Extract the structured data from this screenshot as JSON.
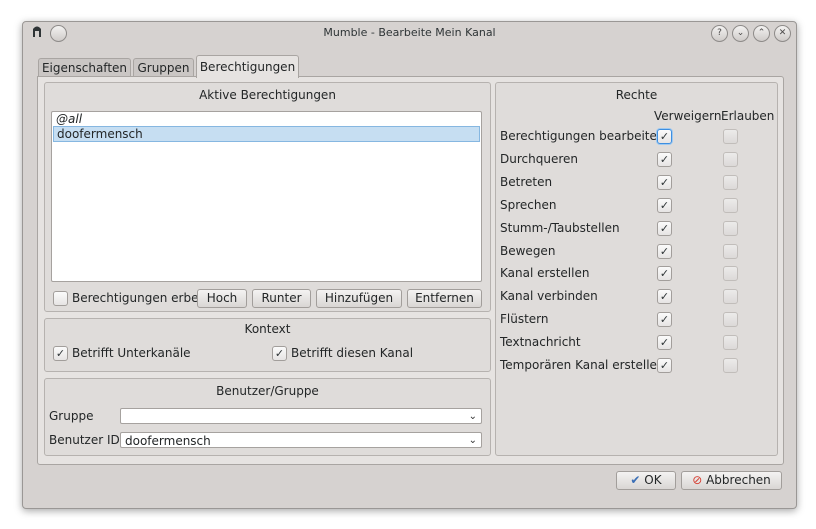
{
  "window": {
    "title": "Mumble - Bearbeite Mein Kanal",
    "controls": [
      "help-icon",
      "minimize-icon",
      "maximize-icon",
      "close-icon"
    ]
  },
  "tabs": [
    {
      "label": "Eigenschaften",
      "active": false
    },
    {
      "label": "Gruppen",
      "active": false
    },
    {
      "label": "Berechtigungen",
      "active": true
    }
  ],
  "active_permissions": {
    "title": "Aktive Berechtigungen",
    "items": [
      {
        "label": "@all",
        "italic": true,
        "selected": false
      },
      {
        "label": "doofermensch",
        "italic": false,
        "selected": true
      }
    ],
    "inherit_checkbox_label": "Berechtigungen erber",
    "inherit_checked": false,
    "buttons": {
      "up": "Hoch",
      "down": "Runter",
      "add": "Hinzufügen",
      "remove": "Entfernen"
    }
  },
  "context": {
    "title": "Kontext",
    "applies_subchannels": {
      "label": "Betrifft Unterkanäle",
      "checked": true
    },
    "applies_channel": {
      "label": "Betrifft diesen Kanal",
      "checked": true
    }
  },
  "user_group": {
    "title": "Benutzer/Gruppe",
    "group_label": "Gruppe",
    "group_value": "",
    "user_id_label": "Benutzer ID",
    "user_id_value": "doofermensch"
  },
  "rights": {
    "title": "Rechte",
    "deny_header": "Verweigern",
    "allow_header": "Erlauben",
    "rows": [
      {
        "label": "Berechtigungen bearbeiten",
        "deny": true,
        "allow": false
      },
      {
        "label": "Durchqueren",
        "deny": true,
        "allow": false
      },
      {
        "label": "Betreten",
        "deny": true,
        "allow": false
      },
      {
        "label": "Sprechen",
        "deny": true,
        "allow": false
      },
      {
        "label": "Stumm-/Taubstellen",
        "deny": true,
        "allow": false
      },
      {
        "label": "Bewegen",
        "deny": true,
        "allow": false
      },
      {
        "label": "Kanal erstellen",
        "deny": true,
        "allow": false
      },
      {
        "label": "Kanal verbinden",
        "deny": true,
        "allow": false
      },
      {
        "label": "Flüstern",
        "deny": true,
        "allow": false
      },
      {
        "label": "Textnachricht",
        "deny": true,
        "allow": false
      },
      {
        "label": "Temporären Kanal erstellen",
        "deny": true,
        "allow": false
      }
    ]
  },
  "footer": {
    "ok": "OK",
    "cancel": "Abbrechen"
  },
  "colors": {
    "selection": "#c6def2",
    "ok_icon": "#3b6fb6",
    "cancel_icon": "#d63b2f"
  }
}
